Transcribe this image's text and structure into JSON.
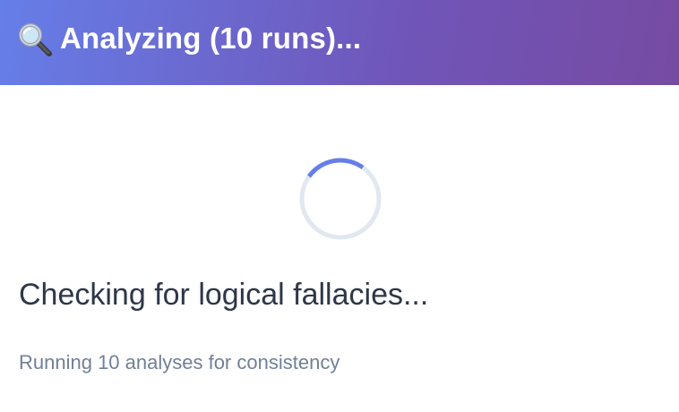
{
  "header": {
    "icon": "magnifying-glass-icon",
    "title": "Analyzing (10 runs)...",
    "gradient_start": "#667eea",
    "gradient_end": "#764ba2"
  },
  "spinner": {
    "icon": "loading-spinner-icon",
    "track_color": "#e2e8f0",
    "accent_color": "#667eea"
  },
  "status": {
    "message": "Checking for logical fallacies...",
    "detail": "Running 10 analyses for consistency"
  }
}
